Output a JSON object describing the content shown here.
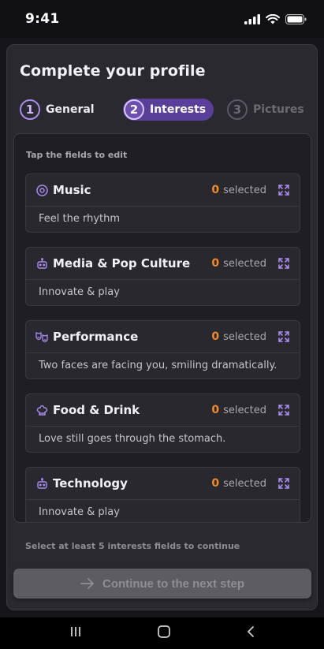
{
  "status_bar": {
    "time": "9:41"
  },
  "page": {
    "title": "Complete your profile"
  },
  "stepper": [
    {
      "number": "1",
      "label": "General"
    },
    {
      "number": "2",
      "label": "Interests"
    },
    {
      "number": "3",
      "label": "Pictures"
    }
  ],
  "panel": {
    "hint": "Tap the fields to edit",
    "cards": [
      {
        "title": "Music",
        "count": "0",
        "count_label": "selected",
        "description": "Feel the rhythm",
        "icon": "vinyl-icon"
      },
      {
        "title": "Media & Pop Culture",
        "count": "0",
        "count_label": "selected",
        "description": "Innovate & play",
        "icon": "robot-icon"
      },
      {
        "title": "Performance",
        "count": "0",
        "count_label": "selected",
        "description": "Two faces are facing you, smiling dramatically.",
        "icon": "theater-masks-icon"
      },
      {
        "title": "Food & Drink",
        "count": "0",
        "count_label": "selected",
        "description": "Love still goes through the stomach.",
        "icon": "chef-hat-icon"
      },
      {
        "title": "Technology",
        "count": "0",
        "count_label": "selected",
        "description": "Innovate & play",
        "icon": "robot-icon"
      }
    ]
  },
  "footer": {
    "hint": "Select at least 5 interests fields to continue",
    "continue_label": "Continue to the next step"
  },
  "colors": {
    "accent": "#a98bf0",
    "count": "#f08a2c",
    "background": "#16151a"
  }
}
